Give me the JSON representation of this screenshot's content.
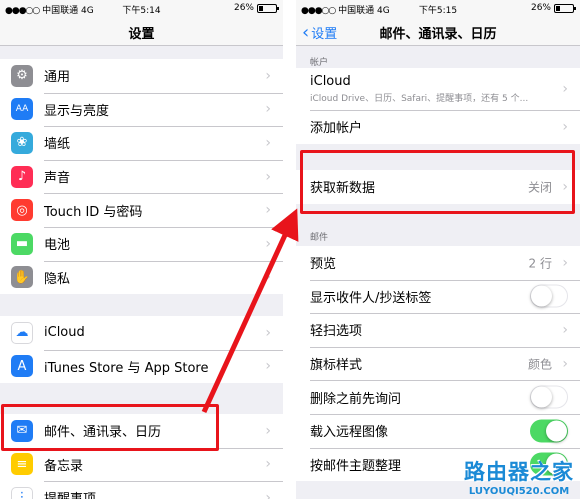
{
  "left_screen": {
    "status": {
      "signal": "●●●○○",
      "carrier": "中国联通",
      "network": "4G",
      "time": "下午5:14",
      "battery": "26%",
      "battery_level": 0.26
    },
    "title": "设置",
    "group1": [
      {
        "label": "通用",
        "icon": "gear-icon",
        "color": "#8e8e93",
        "glyph": "⚙"
      },
      {
        "label": "显示与亮度",
        "icon": "display-icon",
        "color": "#1f7cf5",
        "glyph": "AA"
      },
      {
        "label": "墙纸",
        "icon": "wallpaper-icon",
        "color": "#35aadc",
        "glyph": "❀"
      },
      {
        "label": "声音",
        "icon": "sound-icon",
        "color": "#ff2d55",
        "glyph": "♪"
      },
      {
        "label": "Touch ID 与密码",
        "icon": "fingerprint-icon",
        "color": "#ff3b30",
        "glyph": "◎"
      },
      {
        "label": "电池",
        "icon": "battery-icon",
        "color": "#4cd964",
        "glyph": "▬"
      },
      {
        "label": "隐私",
        "icon": "hand-icon",
        "color": "#8e8e93",
        "glyph": "✋"
      }
    ],
    "group2": [
      {
        "label": "iCloud",
        "icon": "cloud-icon",
        "color": "#ffffff",
        "glyph": "☁"
      },
      {
        "label": "iTunes Store 与 App Store",
        "icon": "app-store-icon",
        "color": "#1f7cf5",
        "glyph": "A"
      }
    ],
    "group3": [
      {
        "label": "邮件、通讯录、日历",
        "icon": "mail-icon",
        "color": "#1f7cf5",
        "glyph": "✉"
      },
      {
        "label": "备忘录",
        "icon": "notes-icon",
        "color": "#ffcc00",
        "glyph": "≡"
      },
      {
        "label": "提醒事项",
        "icon": "reminders-icon",
        "color": "#ffffff",
        "glyph": "⋮"
      }
    ]
  },
  "right_screen": {
    "status": {
      "signal": "●●●○○",
      "carrier": "中国联通",
      "network": "4G",
      "time": "下午5:15",
      "battery": "26%",
      "battery_level": 0.26
    },
    "back": "设置",
    "title": "邮件、通讯录、日历",
    "accounts_header": "帐户",
    "icloud": {
      "title": "iCloud",
      "subtitle": "iCloud Drive、日历、Safari、提醒事项，还有 5 个..."
    },
    "add_account": "添加帐户",
    "fetch": {
      "label": "获取新数据",
      "value": "关闭"
    },
    "mail_header": "邮件",
    "mail_rows": [
      {
        "label": "预览",
        "value": "2 行",
        "kind": "value"
      },
      {
        "label": "显示收件人/抄送标签",
        "kind": "toggle",
        "on": false
      },
      {
        "label": "轻扫选项",
        "kind": "chevron"
      },
      {
        "label": "旗标样式",
        "value": "颜色",
        "kind": "value"
      },
      {
        "label": "删除之前先询问",
        "kind": "toggle",
        "on": false
      },
      {
        "label": "载入远程图像",
        "kind": "toggle",
        "on": true
      },
      {
        "label": "按邮件主题整理",
        "kind": "toggle",
        "on": true
      }
    ]
  },
  "annotation": {
    "color": "#e8141b"
  },
  "watermark": {
    "logo": "路由器之家",
    "url": "LUYOUQI520.COM"
  }
}
